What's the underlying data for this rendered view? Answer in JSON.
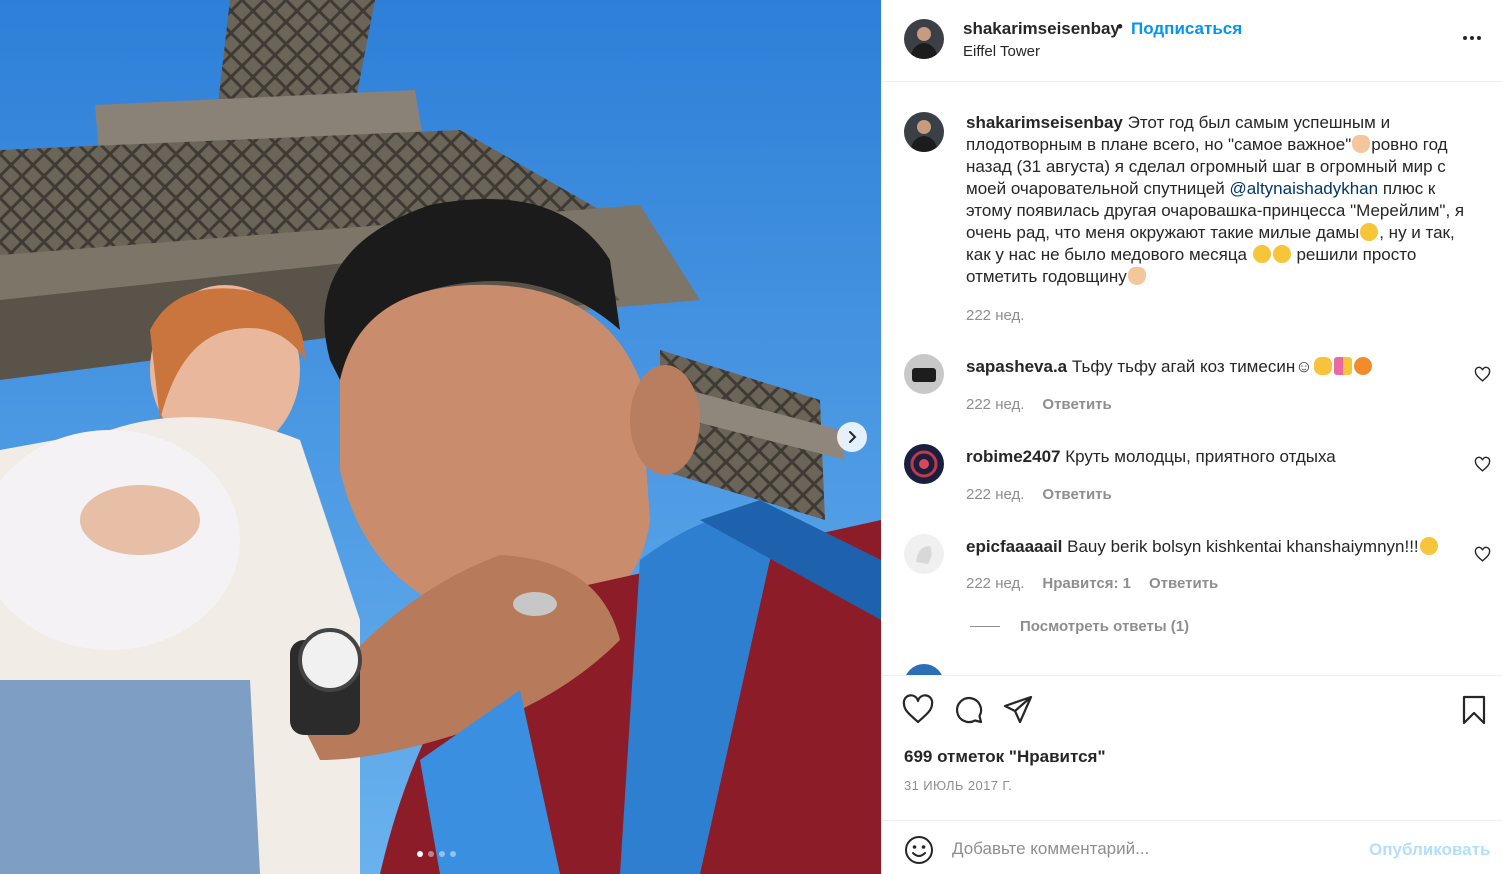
{
  "post": {
    "username": "shakarimseisenbay",
    "separator": "•",
    "follow_label": "Подписаться",
    "location": "Eiffel Tower",
    "more_icon": "more-horizontal-icon"
  },
  "caption": {
    "username": "shakarimseisenbay",
    "part1": " Этот год был самым успешным и плодотворным в плане всего, но \"самое важное\"",
    "part2": "ровно год назад (31 августа) я сделал огромный шаг в огромный мир с моей очаровательной спутницей ",
    "mention": "@altynaishadykhan",
    "part3": " плюс к этому появилась другая очаровашка-принцесса \"Мерейлим\", я очень рад, что меня окружают такие милые дамы",
    "part4": ", ну и так, как у нас не было медового месяца ",
    "part5": " решили просто отметить годовщину",
    "time": "222 нед."
  },
  "comments": [
    {
      "username": "sapasheva.a",
      "text": " Тьфу тьфу агай коз тимесин☺",
      "time": "222 нед.",
      "reply_label": "Ответить"
    },
    {
      "username": "robime2407",
      "text": " Круть молодцы, приятного отдыха",
      "time": "222 нед.",
      "reply_label": "Ответить"
    },
    {
      "username": "epicfaaaaail",
      "text": " Bauy berik bolsyn kishkentai khanshaiymnyn!!!",
      "time": "222 нед.",
      "likes_label": "Нравится: 1",
      "reply_label": "Ответить"
    }
  ],
  "view_replies_label": "Посмотреть ответы (1)",
  "actions": {
    "icons": [
      "heart-icon",
      "comment-icon",
      "share-icon",
      "bookmark-icon"
    ],
    "likes_text": "699 отметок \"Нравится\"",
    "date_text": "31 ИЮЛЬ 2017 Г."
  },
  "add_comment": {
    "placeholder": "Добавьте комментарий...",
    "publish_label": "Опубликовать"
  },
  "carousel": {
    "slide_count": 4,
    "active_index": 0
  },
  "colors": {
    "link_blue": "#0095f6",
    "mention_blue": "#00376b",
    "text_main": "#262626",
    "text_muted": "#8e8e8e",
    "publish_disabled": "#b2dffc"
  }
}
